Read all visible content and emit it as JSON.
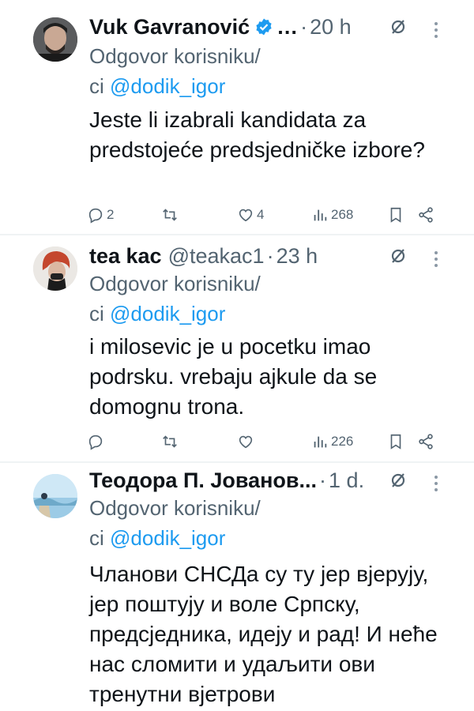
{
  "tweets": [
    {
      "name": "Vuk Gavranović",
      "name_suffix": "…",
      "handle": "",
      "time": "20 h",
      "reply_prefix": "Odgovor korisniku/",
      "reply_line2_prefix": "ci",
      "mention": "@dodik_igor",
      "text": "Jeste li izabrali kandidata za predstojeće predsjedničke izbore?",
      "replies": "2",
      "retweets": "",
      "likes": "4",
      "views": "268",
      "verified": true
    },
    {
      "name": "tea kac",
      "handle": "@teakac1",
      "time": "23 h",
      "reply_prefix": "Odgovor korisniku/",
      "reply_line2_prefix": "ci",
      "mention": "@dodik_igor",
      "text": "i milosevic je u pocetku imao podrsku. vrebaju ajkule da se domognu trona.",
      "replies": "",
      "retweets": "",
      "likes": "",
      "views": "226",
      "verified": false
    },
    {
      "name": "Теодора П. Јованов...",
      "handle": "",
      "time": "1 d.",
      "reply_prefix": "Odgovor korisniku/",
      "reply_line2_prefix": "ci",
      "mention": "@dodik_igor",
      "text": "Чланови СНСДа су ту јер вјерују, јер поштују и воле Српску, предсједника, идеју и рад! И неће нас сломити и удаљити ови тренутни вјетрови",
      "verified": false
    }
  ],
  "colors": {
    "accent": "#1d9bf0",
    "muted": "#536471",
    "text": "#0f1419"
  },
  "icons": [
    "verified-badge-icon",
    "grok-icon",
    "more-icon",
    "reply-icon",
    "retweet-icon",
    "like-icon",
    "views-icon",
    "bookmark-icon",
    "share-icon"
  ]
}
